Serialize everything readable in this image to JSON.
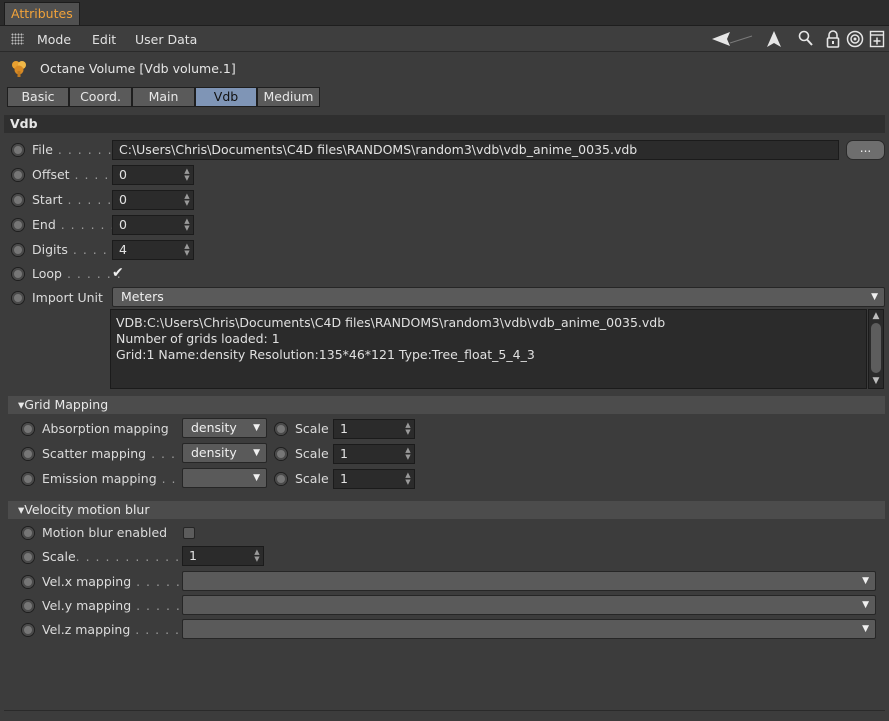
{
  "window": {
    "tab_title": "Attributes"
  },
  "menubar": {
    "items": [
      "Mode",
      "Edit",
      "User Data"
    ],
    "icons": [
      "back-arrow-icon",
      "cursor-up-icon",
      "search-icon",
      "lock-icon",
      "target-icon",
      "new-panel-icon"
    ]
  },
  "object": {
    "title": "Octane Volume [Vdb volume.1]"
  },
  "tabs": [
    {
      "label": "Basic",
      "active": false
    },
    {
      "label": "Coord.",
      "active": false
    },
    {
      "label": "Main",
      "active": false
    },
    {
      "label": "Vdb",
      "active": true
    },
    {
      "label": "Medium",
      "active": false
    }
  ],
  "vdb": {
    "section_label": "Vdb",
    "file": {
      "label": "File",
      "dots": " . . . . . . . .",
      "value": "C:\\Users\\Chris\\Documents\\C4D files\\RANDOMS\\random3\\vdb\\vdb_anime_0035.vdb",
      "browse_label": "..."
    },
    "offset": {
      "label": "Offset",
      "dots": " . . . . .",
      "value": "0"
    },
    "start": {
      "label": "Start",
      "dots": " . . . . . .",
      "value": "0"
    },
    "end": {
      "label": "End",
      "dots": " . . . . . . .",
      "value": "0"
    },
    "digits": {
      "label": "Digits",
      "dots": " . . . . .",
      "value": "4"
    },
    "loop": {
      "label": "Loop",
      "dots": " . . . . . .",
      "checked_glyph": "✔"
    },
    "import_unit": {
      "label": "Import Unit",
      "value": "Meters"
    },
    "info_lines": [
      "VDB:C:\\Users\\Chris\\Documents\\C4D files\\RANDOMS\\random3\\vdb\\vdb_anime_0035.vdb",
      "Number of grids loaded: 1",
      "Grid:1  Name:density  Resolution:135*46*121  Type:Tree_float_5_4_3"
    ]
  },
  "grid_mapping": {
    "label": "▾Grid Mapping",
    "absorption": {
      "label": "Absorption mapping",
      "dots": "",
      "value": "density",
      "scale_label": "Scale",
      "scale_value": "1"
    },
    "scatter": {
      "label": "Scatter mapping",
      "dots": " . . . .",
      "value": "density",
      "scale_label": "Scale",
      "scale_value": "1"
    },
    "emission": {
      "label": "Emission mapping",
      "dots": " . .",
      "value": "",
      "scale_label": "Scale",
      "scale_value": "1"
    }
  },
  "velocity": {
    "label": "▾Velocity motion blur",
    "motion_blur": {
      "label": "Motion blur enabled"
    },
    "scale": {
      "label": "Scale",
      "dots": ". . . . . . . . . . . . . .",
      "value": "1"
    },
    "vel_x": {
      "label": "Vel.x mapping",
      "dots": " . . . . . .",
      "value": ""
    },
    "vel_y": {
      "label": "Vel.y mapping",
      "dots": " . . . . . .",
      "value": ""
    },
    "vel_z": {
      "label": "Vel.z mapping",
      "dots": " . . . . . .",
      "value": ""
    }
  },
  "colors": {
    "accent_title": "#f2a33a",
    "active_tab": "#7f95b6",
    "field_bg": "#2b2b2b",
    "panel_bg": "#3c3c3c"
  }
}
